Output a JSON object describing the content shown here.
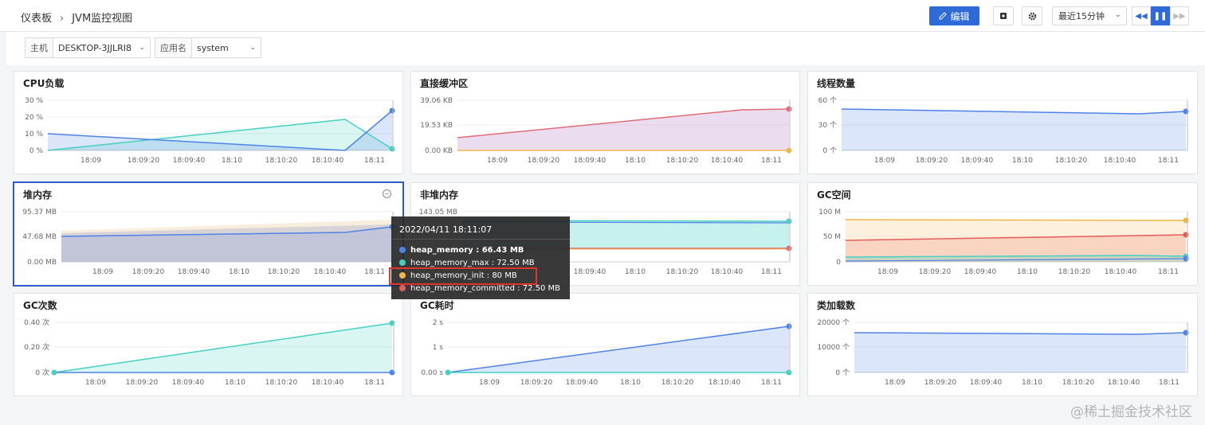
{
  "header": {
    "breadcrumb_root": "仪表板",
    "breadcrumb_sep": "›",
    "breadcrumb_current": "JVM监控视图",
    "edit_label": "编辑",
    "time_range": "最近15分钟"
  },
  "filters": {
    "host_label": "主机",
    "host_value": "DESKTOP-3JJLRI8",
    "app_label": "应用名",
    "app_value": "system"
  },
  "x_ticks": [
    "18:09",
    "18:09:20",
    "18:09:40",
    "18:10",
    "18:10:20",
    "18:10:40",
    "18:11"
  ],
  "panels": [
    {
      "title": "CPU负载",
      "y_ticks": [
        "30 %",
        "20 %",
        "10 %",
        "0 %"
      ]
    },
    {
      "title": "直接缓冲区",
      "y_ticks": [
        "39.06 KB",
        "19.53 KB",
        "0.00 KB"
      ]
    },
    {
      "title": "线程数量",
      "y_ticks": [
        "60 个",
        "30 个",
        "0 个"
      ]
    },
    {
      "title": "堆内存",
      "y_ticks": [
        "95.37 MB",
        "47.68 MB",
        "0.00 MB"
      ]
    },
    {
      "title": "非堆内存",
      "y_ticks": [
        "143.05 MB"
      ]
    },
    {
      "title": "GC空间",
      "y_ticks": [
        "100 M",
        "50 M",
        "0"
      ]
    },
    {
      "title": "GC次数",
      "y_ticks": [
        "0.40 次",
        "0.20 次",
        "0 次"
      ]
    },
    {
      "title": "GC耗时",
      "y_ticks": [
        "2 s",
        "1 s",
        "0.00 s"
      ]
    },
    {
      "title": "类加载数",
      "y_ticks": [
        "20000 个",
        "10000 个",
        "0 个"
      ]
    }
  ],
  "tooltip": {
    "time": "2022/04/11 18:11:07",
    "rows": [
      {
        "name": "heap_memory",
        "value": "66.43 MB",
        "color": "#4f82e8",
        "bold": true
      },
      {
        "name": "heap_memory_max",
        "value": "72.50 MB",
        "color": "#45d0c2",
        "bold": false
      },
      {
        "name": "heap_memory_init",
        "value": "80 MB",
        "color": "#f0b64a",
        "bold": false
      },
      {
        "name": "heap_memory_committed",
        "value": "72.50 MB",
        "color": "#e65c5c",
        "bold": false
      }
    ]
  },
  "colors": {
    "blue": "#4f82e8",
    "teal": "#45d0c2",
    "red": "#e06c75",
    "orange": "#f0b64a",
    "accent": "#2f6ad9"
  },
  "watermark": "@稀土掘金技术社区"
}
